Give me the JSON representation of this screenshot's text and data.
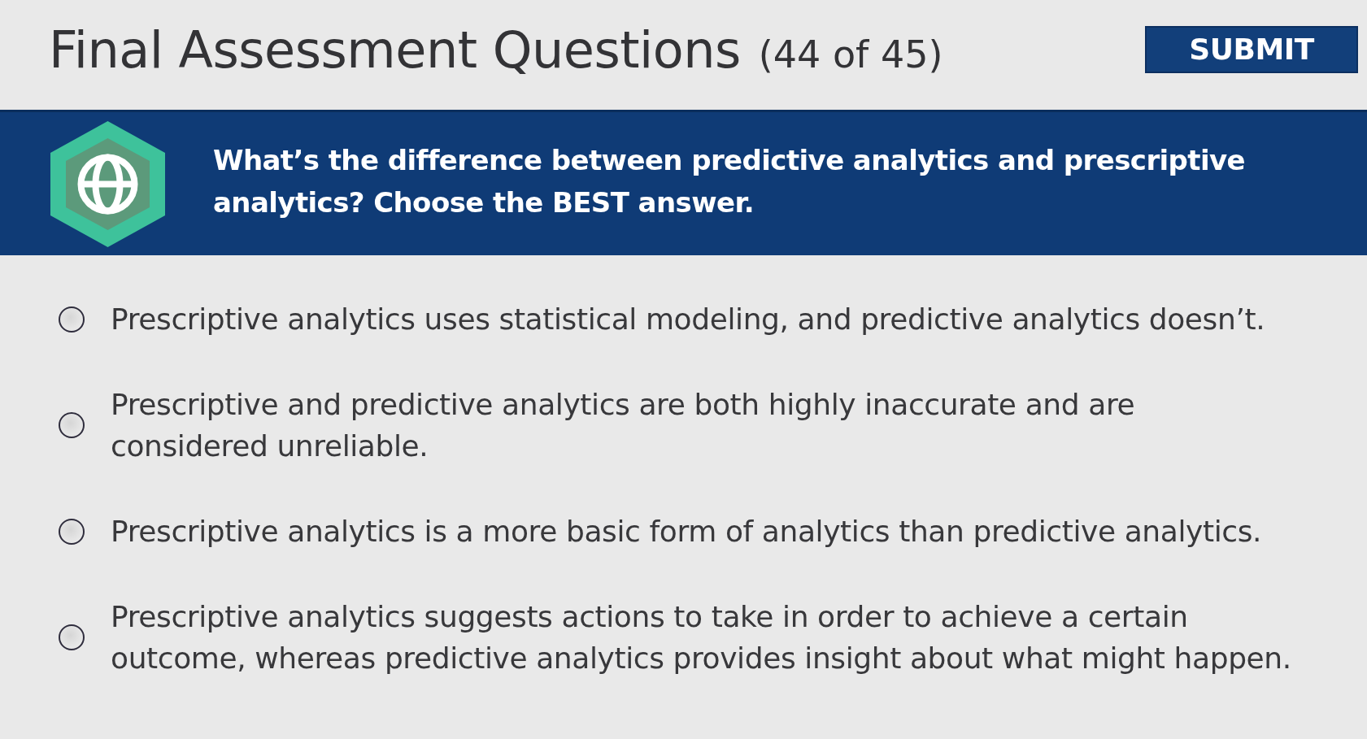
{
  "header": {
    "title": "Final Assessment Questions",
    "progress": "(44 of 45)"
  },
  "submit_button": {
    "label": "SUBMIT"
  },
  "question": {
    "text": "What’s the difference between predictive analytics and prescriptive analytics? Choose the BEST answer."
  },
  "options": [
    {
      "text": "Prescriptive analytics uses statistical modeling, and predictive analytics doesn’t.",
      "selected": false
    },
    {
      "text": "Prescriptive and predictive analytics are both highly inaccurate and are considered unreliable.",
      "selected": false
    },
    {
      "text": "Prescriptive analytics is a more basic form of analytics than predictive analytics.",
      "selected": false
    },
    {
      "text": "Prescriptive analytics suggests actions to take in order to achieve a certain outcome, whereas predictive analytics provides insight about what might happen.",
      "selected": false
    }
  ]
}
